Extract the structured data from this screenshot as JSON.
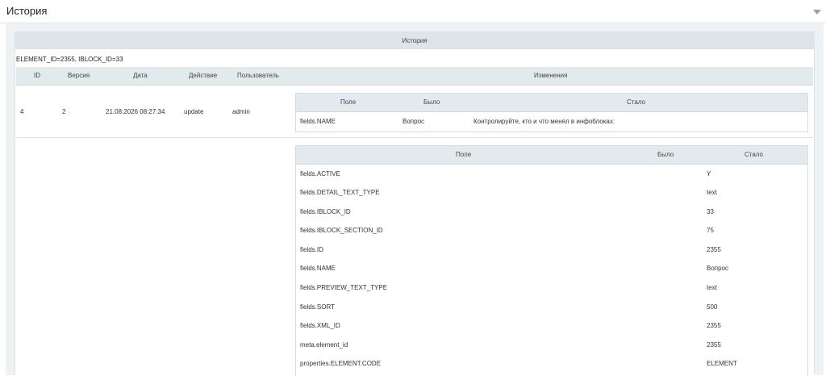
{
  "header": {
    "title": "История"
  },
  "band": {
    "title": "История"
  },
  "ids_line": "ELEMENT_ID=2355, IBLOCK_ID=33",
  "history_table": {
    "columns": [
      "ID",
      "Версия",
      "Дата",
      "Действие",
      "Пользователь",
      "Изменения"
    ],
    "row": {
      "id": "4",
      "version": "2",
      "date": "21.08.2026 08:27:34",
      "action": "update",
      "user": "admin"
    }
  },
  "changes_table": {
    "columns": [
      "Поле",
      "Было",
      "Стало"
    ],
    "rows": [
      {
        "field": "fields.NAME",
        "was": "Вопрос",
        "now": "Контролируйте, кто и что менял в инфоблоках:"
      }
    ]
  },
  "full_table": {
    "columns": [
      "Поле",
      "Было",
      "Стало"
    ],
    "rows": [
      {
        "field": "fields.ACTIVE",
        "was": "",
        "now": "Y"
      },
      {
        "field": "fields.DETAIL_TEXT_TYPE",
        "was": "",
        "now": "text"
      },
      {
        "field": "fields.IBLOCK_ID",
        "was": "",
        "now": "33"
      },
      {
        "field": "fields.IBLOCK_SECTION_ID",
        "was": "",
        "now": "75"
      },
      {
        "field": "fields.ID",
        "was": "",
        "now": "2355"
      },
      {
        "field": "fields.NAME",
        "was": "",
        "now": "Вопрос"
      },
      {
        "field": "fields.PREVIEW_TEXT_TYPE",
        "was": "",
        "now": "text"
      },
      {
        "field": "fields.SORT",
        "was": "",
        "now": "500"
      },
      {
        "field": "fields.XML_ID",
        "was": "",
        "now": "2355"
      },
      {
        "field": "meta.element_id",
        "was": "",
        "now": "2355"
      },
      {
        "field": "properties.ELEMENT.CODE",
        "was": "",
        "now": "ELEMENT"
      }
    ]
  }
}
